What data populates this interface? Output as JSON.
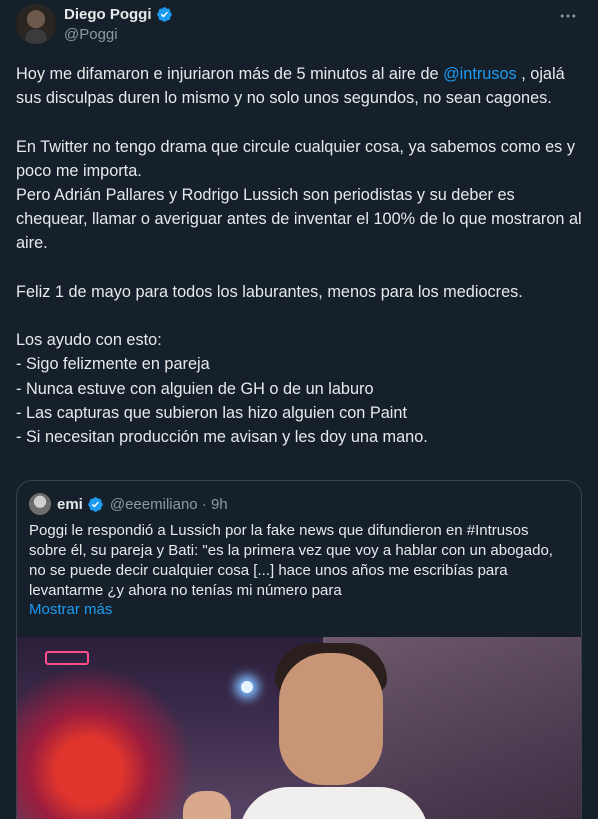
{
  "author": {
    "display_name": "Diego Poggi",
    "handle": "@Poggi"
  },
  "more_icon": "more-horizontal-icon",
  "tweet": {
    "line_1_before": "Hoy me difamaron e injuriaron más de 5 minutos al aire de ",
    "mention": "@intrusos",
    "line_1_after": " , ojalá sus disculpas duren lo mismo y no solo unos segundos, no sean cagones.",
    "para_2a": "En Twitter no tengo drama que circule cualquier cosa, ya sabemos como es y poco me importa.",
    "para_2b": "Pero Adrián Pallares y Rodrigo Lussich son periodistas y su deber es chequear, llamar o averiguar antes de inventar el 100% de lo que mostraron al aire.",
    "para_3": "Feliz 1 de mayo para todos los laburantes, menos para los mediocres.",
    "para_4_title": "Los ayudo con esto:",
    "list": [
      "- Sigo felizmente en pareja",
      "- Nunca estuve con alguien de GH o de un laburo",
      "- Las capturas que subieron las hizo alguien con Paint",
      "- Si necesitan producción me avisan y les doy una mano."
    ]
  },
  "quote": {
    "display_name": "emi",
    "handle_time": "@eeemiliano · 9h",
    "text": "Poggi le respondió a Lussich por la fake news que difundieron en #Intrusos sobre él, su pareja y Bati: \"es la primera vez que voy a hablar con un abogado, no se puede decir cualquier cosa [...] hace unos años me escribías para levantarme ¿y ahora no tenías mi número para",
    "show_more": "Mostrar más"
  },
  "colors": {
    "background": "#15202b",
    "text": "#e7e9ea",
    "secondary": "#8b98a5",
    "accent": "#1d9bf0",
    "border": "#38444d"
  }
}
